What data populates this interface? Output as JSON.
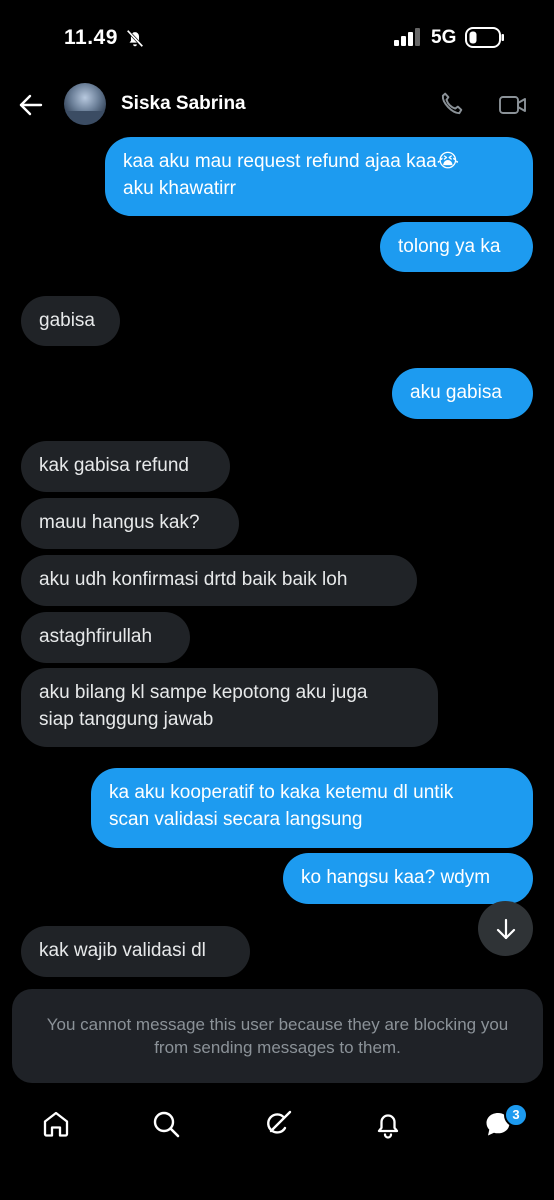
{
  "status_bar": {
    "time": "11.49",
    "network": "5G"
  },
  "header": {
    "contact_name": "Siska Sabrina"
  },
  "messages": [
    {
      "text": "kaa aku mau request refund ajaa kaa😭\naku khawatirr",
      "side": "out"
    },
    {
      "text": "tolong ya ka",
      "side": "out"
    },
    {
      "text": "gabisa",
      "side": "in"
    },
    {
      "text": "aku gabisa",
      "side": "out"
    },
    {
      "text": "kak gabisa refund",
      "side": "in"
    },
    {
      "text": "mauu hangus kak?",
      "side": "in"
    },
    {
      "text": "aku udh konfirmasi drtd baik baik loh",
      "side": "in"
    },
    {
      "text": "astaghfirullah",
      "side": "in"
    },
    {
      "text": "aku bilang kl sampe kepotong aku juga\nsiap tanggung jawab",
      "side": "in"
    },
    {
      "text": "ka aku kooperatif to kaka ketemu dl untik\nscan validasi secara langsung",
      "side": "out"
    },
    {
      "text": "ko hangsu kaa? wdym",
      "side": "out"
    },
    {
      "text": "kak wajib validasi dl",
      "side": "in"
    }
  ],
  "blocked_notice": "You cannot message this user because they are blocking you from sending messages to them.",
  "bottom_nav": {
    "items": [
      {
        "icon": "home-icon"
      },
      {
        "icon": "search-icon"
      },
      {
        "icon": "grok-icon"
      },
      {
        "icon": "bell-icon"
      },
      {
        "icon": "messages-icon"
      }
    ],
    "messages_badge": "3"
  },
  "colors": {
    "accent": "#1d9bf0",
    "incoming_bubble": "#202327",
    "background": "#000000"
  }
}
